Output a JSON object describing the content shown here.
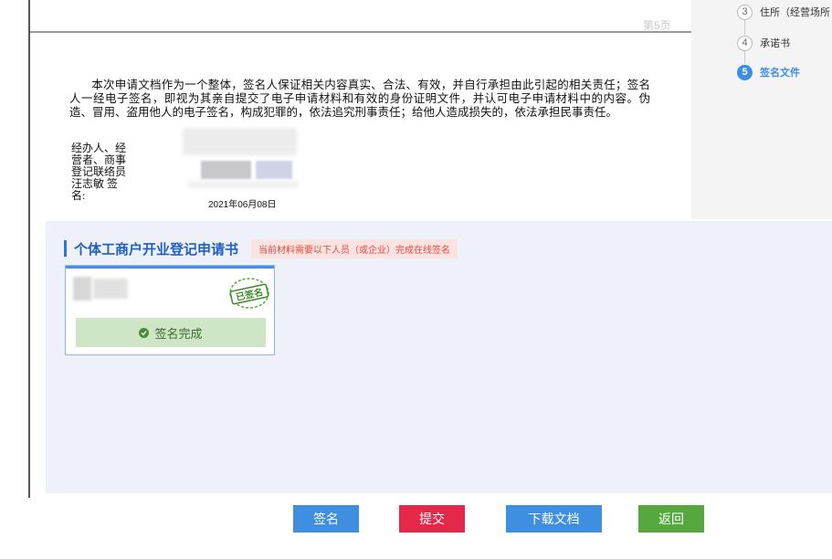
{
  "document": {
    "page_label": "第5页",
    "paragraph": "本次申请文档作为一个整体，签名人保证相关内容真实、合法、有效，并自行承担由此引起的相关责任；签名人一经电子签名，即视为其亲自提交了电子申请材料和有效的身份证明文件，并认可电子申请材料中的内容。伪造、冒用、盗用他人的电子签名，构成犯罪的，依法追究刑事责任；给他人造成损失的，依法承担民事责任。",
    "signer_label": "经办人、经营者、商事登记联络员汪志敏 签名:",
    "sign_date": "2021年06月08日"
  },
  "steps": [
    {
      "num": "3",
      "label": "住所（经营场所",
      "active": false
    },
    {
      "num": "4",
      "label": "承诺书",
      "active": false
    },
    {
      "num": "5",
      "label": "签名文件",
      "active": true
    }
  ],
  "sign_panel": {
    "title": "个体工商户开业登记申请书",
    "notice": "当前材料需要以下人员（或企业）完成在线签名",
    "card": {
      "stamp_text": "已签名",
      "status": "签名完成"
    }
  },
  "buttons": {
    "sign": "签名",
    "submit": "提交",
    "download": "下载文档",
    "back": "返回"
  },
  "colors": {
    "primary_blue": "#3f8fe0",
    "submit_red": "#e5284a",
    "back_green": "#55a83d",
    "status_green_bg": "#cfe6c6",
    "notice_red": "#e04b3f"
  }
}
